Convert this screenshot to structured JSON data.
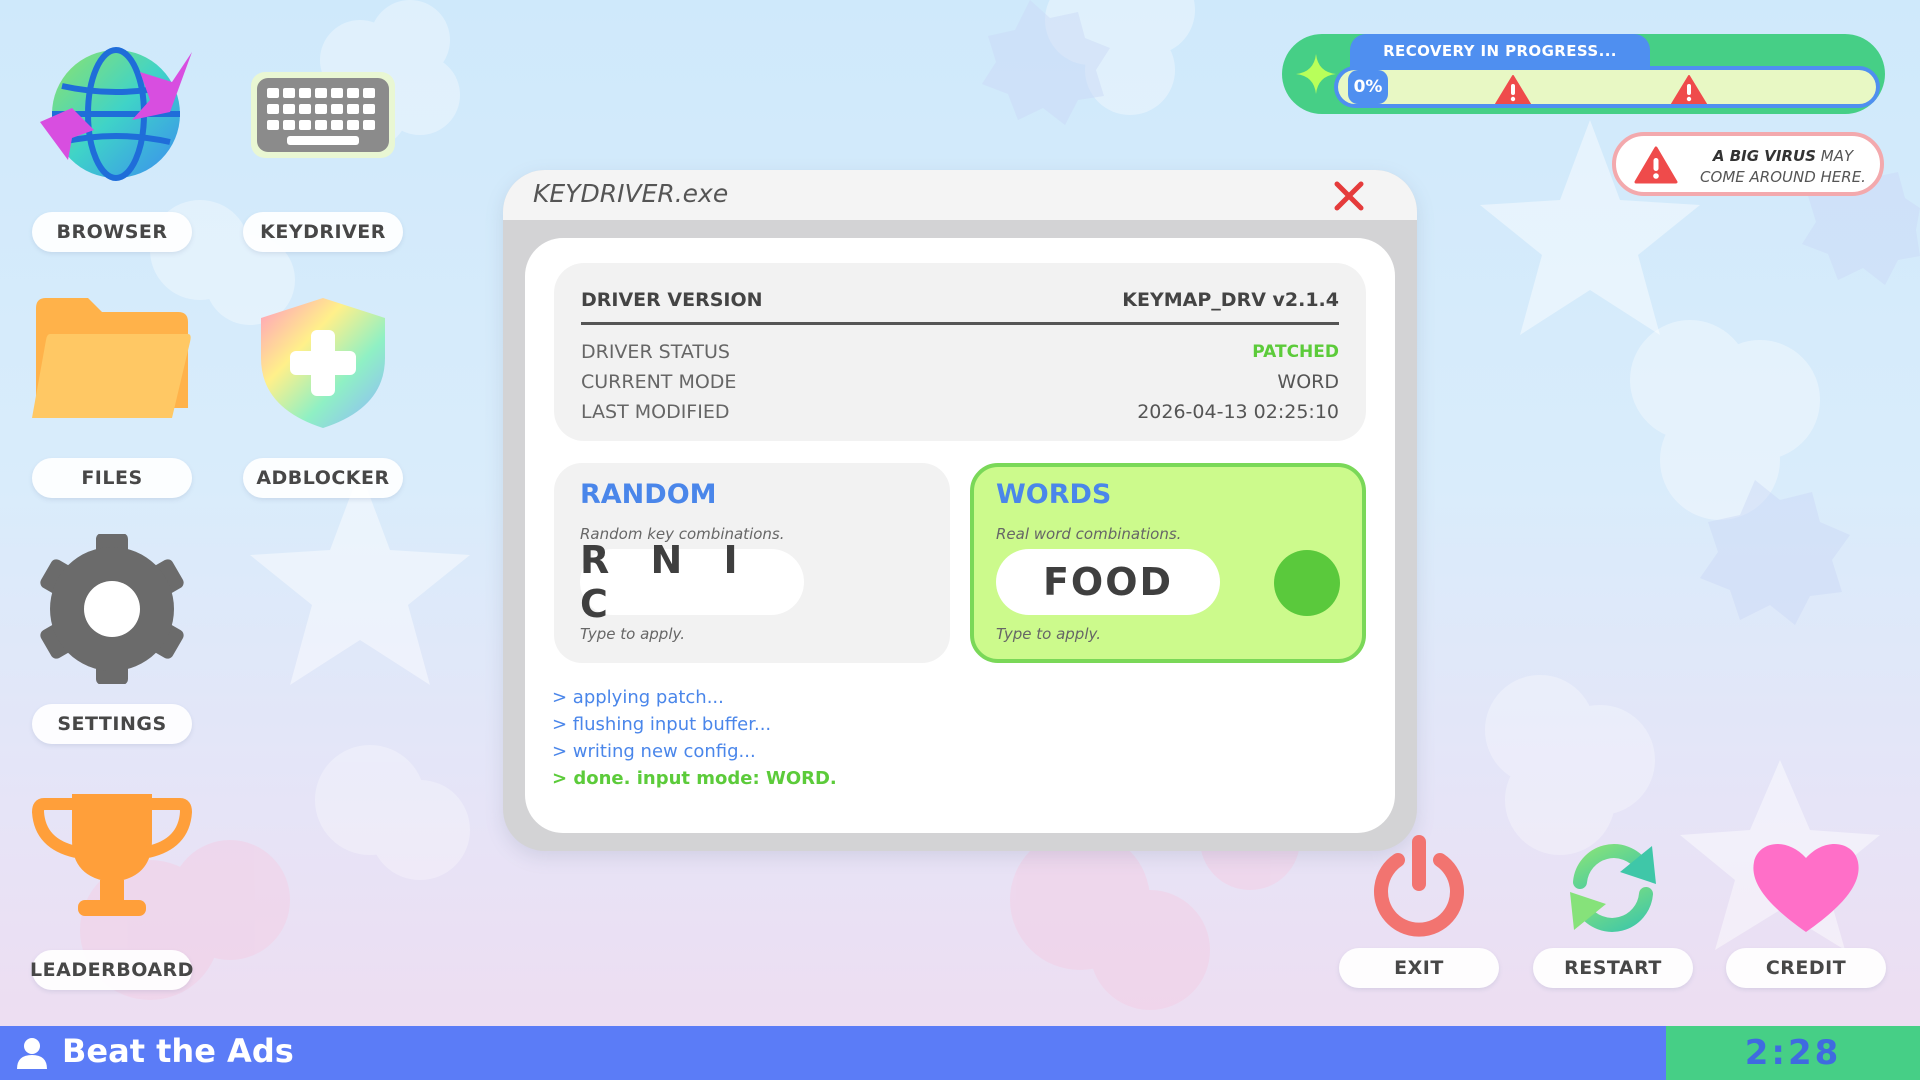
{
  "desktop": {
    "icons": [
      {
        "label": "BROWSER",
        "icon": "globe-icon"
      },
      {
        "label": "KEYDRIVER",
        "icon": "keyboard-icon"
      },
      {
        "label": "FILES",
        "icon": "folder-icon"
      },
      {
        "label": "ADBLOCKER",
        "icon": "shield-plus-icon"
      },
      {
        "label": "SETTINGS",
        "icon": "gear-icon"
      },
      {
        "label": "LEADERBOARD",
        "icon": "trophy-icon"
      }
    ]
  },
  "recovery": {
    "title": "RECOVERY IN PROGRESS...",
    "percent_label": "0%",
    "progress": 0,
    "warning_icon": "warning-icon",
    "colors": {
      "pill": "#46cf86",
      "bar": "#4f8ff0",
      "track": "#e8f8c4"
    }
  },
  "virus_notice": {
    "bold_text": "A BIG VIRUS",
    "text_after_bold": " MAY",
    "text_line2": "COME AROUND HERE.",
    "icon": "warning-icon"
  },
  "window": {
    "title": "KEYDRIVER.exe",
    "close_icon": "close-icon",
    "info": {
      "header_label": "DRIVER VERSION",
      "header_value": "KEYMAP_DRV v2.1.4",
      "rows": [
        {
          "label": "DRIVER STATUS",
          "value": "PATCHED"
        },
        {
          "label": "CURRENT MODE",
          "value": "WORD"
        },
        {
          "label": "LAST MODIFIED",
          "value": "2026-04-13 02:25:10"
        }
      ]
    },
    "modes": {
      "random": {
        "title": "RANDOM",
        "description": "Random key combinations.",
        "keys": "R N I C",
        "hint": "Type to apply."
      },
      "words": {
        "title": "WORDS",
        "description": "Real word combinations.",
        "keys": "FOOD",
        "hint": "Type to apply.",
        "active": true
      }
    },
    "log": [
      "> applying patch...",
      "> flushing input buffer...",
      "> writing new config...",
      "> done. input mode: WORD."
    ]
  },
  "actions": [
    {
      "label": "EXIT",
      "icon": "power-icon"
    },
    {
      "label": "RESTART",
      "icon": "restart-icon"
    },
    {
      "label": "CREDIT",
      "icon": "heart-icon"
    }
  ],
  "taskbar": {
    "user_icon": "user-icon",
    "title": "Beat the Ads",
    "timer": "2:28"
  },
  "colors": {
    "accent_blue": "#4a86ea",
    "success_green": "#5ccb3a",
    "taskbar": "#5b7cf7",
    "timer_bg": "#46cf86"
  }
}
